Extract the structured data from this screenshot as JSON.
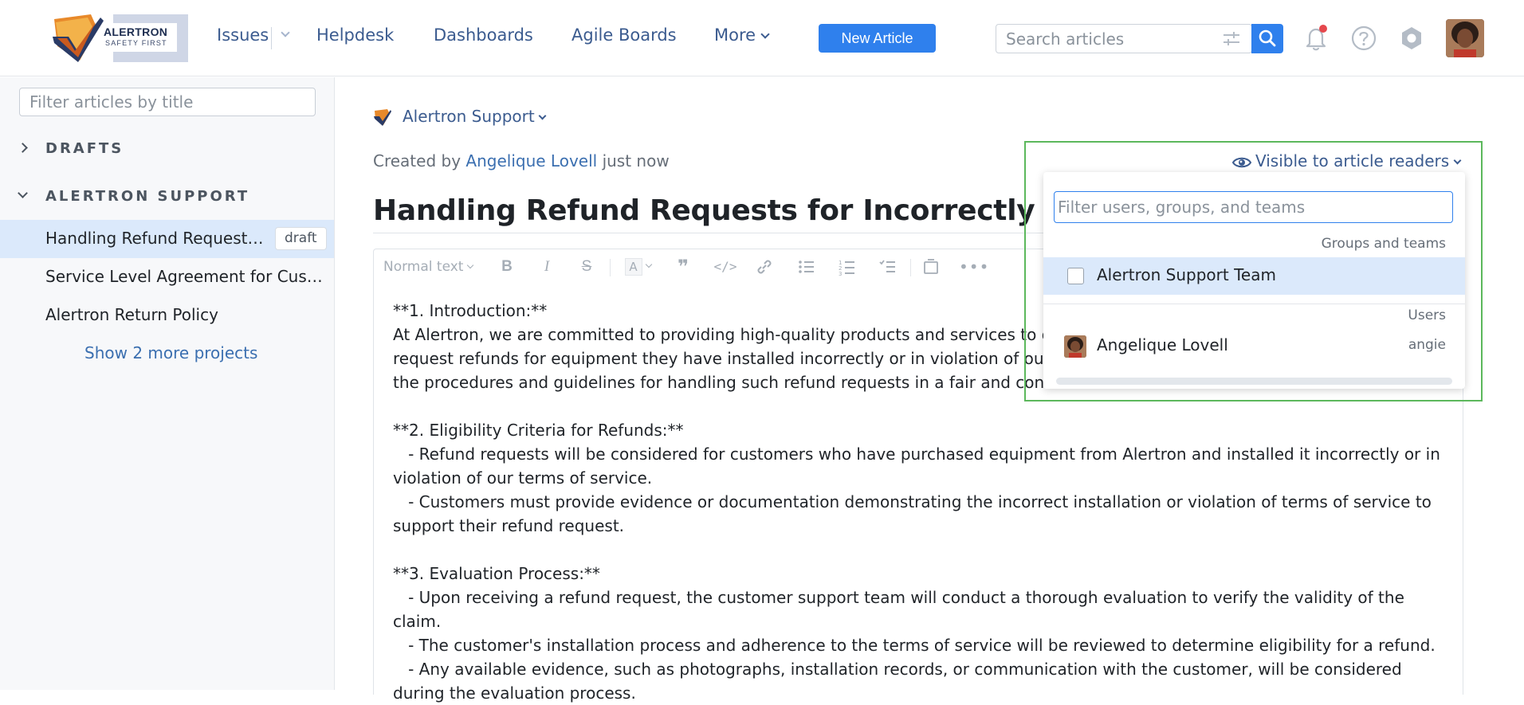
{
  "brand": {
    "name": "ALERTRON",
    "tagline": "SAFETY FIRST"
  },
  "nav": {
    "issues": "Issues",
    "helpdesk": "Helpdesk",
    "dashboards": "Dashboards",
    "agile_boards": "Agile Boards",
    "more": "More",
    "new_article": "New Article"
  },
  "search": {
    "placeholder": "Search articles"
  },
  "sidebar": {
    "filter_placeholder": "Filter articles by title",
    "drafts_label": "DRAFTS",
    "project_label": "ALERTRON SUPPORT",
    "articles": [
      {
        "title": "Handling Refund Requests for Incorrectly Installed Equipment",
        "badge": "draft"
      },
      {
        "title": "Service Level Agreement for Customer Support"
      },
      {
        "title": "Alertron Return Policy"
      }
    ],
    "show_more": "Show 2 more projects"
  },
  "article": {
    "project": "Alertron Support",
    "created_prefix": "Created by",
    "author": "Angelique Lovell",
    "created_suffix": "just now",
    "title": "Handling Refund Requests for Incorrectly Installed Equipment",
    "toolbar_style": "Normal text",
    "body": "**1. Introduction:**\nAt Alertron, we are committed to providing high-quality products and services to o\nrequest refunds for equipment they have installed incorrectly or in violation of our\nthe procedures and guidelines for handling such refund requests in a fair and cons\n\n**2. Eligibility Criteria for Refunds:**\n   - Refund requests will be considered for customers who have purchased equipment from Alertron and installed it incorrectly or in\nviolation of our terms of service.\n   - Customers must provide evidence or documentation demonstrating the incorrect installation or violation of terms of service to\nsupport their refund request.\n\n**3. Evaluation Process:**\n   - Upon receiving a refund request, the customer support team will conduct a thorough evaluation to verify the validity of the claim.\n   - The customer's installation process and adherence to the terms of service will be reviewed to determine eligibility for a refund.\n   - Any available evidence, such as photographs, installation records, or communication with the customer, will be considered\nduring the evaluation process."
  },
  "visibility": {
    "trigger_label": "Visible to article readers",
    "filter_placeholder": "Filter users, groups, and teams",
    "groups_heading": "Groups and teams",
    "team_name": "Alertron Support Team",
    "users_heading": "Users",
    "user_name": "Angelique Lovell",
    "user_login": "angie"
  },
  "colors": {
    "accent": "#2f80ed",
    "link": "#3b5b8f",
    "selected_row": "#dbe9fb",
    "highlight_frame": "#5cb85c",
    "notification_dot": "#e5484d"
  },
  "icons": [
    "logo-mark",
    "filter-sliders-icon",
    "search-icon",
    "bell-icon",
    "help-icon",
    "hexagon-settings-icon",
    "eye-icon",
    "chevron-down-icon"
  ]
}
